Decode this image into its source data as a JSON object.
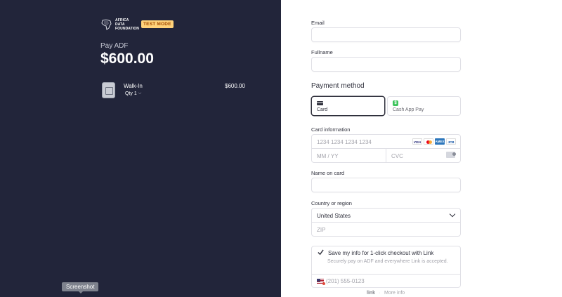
{
  "brand": {
    "logo_text": "AFRICA DATA FOUNDATION",
    "test_badge": "TEST MODE"
  },
  "summary": {
    "pay_label": "Pay ADF",
    "amount": "$600.00",
    "item": {
      "name": "Walk-In",
      "qty_label": "Qty 1",
      "price": "$600.00"
    }
  },
  "form": {
    "email_label": "Email",
    "fullname_label": "Fullname",
    "payment_method_title": "Payment method",
    "methods": [
      {
        "label": "Card",
        "icon": "card-icon",
        "selected": true
      },
      {
        "label": "Cash App Pay",
        "icon": "cash-app-icon",
        "selected": false
      }
    ],
    "card_info_label": "Card information",
    "card_number_placeholder": "1234 1234 1234 1234",
    "expiry_placeholder": "MM / YY",
    "cvc_placeholder": "CVC",
    "card_brands": [
      "VISA",
      "MC",
      "AMEX",
      "JCB"
    ],
    "name_on_card_label": "Name on card",
    "country_label": "Country or region",
    "country_value": "United States",
    "zip_placeholder": "ZIP",
    "save_info": {
      "checked": true,
      "title": "Save my info for 1-click checkout with Link",
      "description": "Securely pay on ADF and everywhere Link is accepted.",
      "phone_placeholder": "(201) 555-0123"
    },
    "footer": {
      "link_label": "link",
      "more_info": "More info"
    }
  },
  "tooltip": "Screenshot"
}
